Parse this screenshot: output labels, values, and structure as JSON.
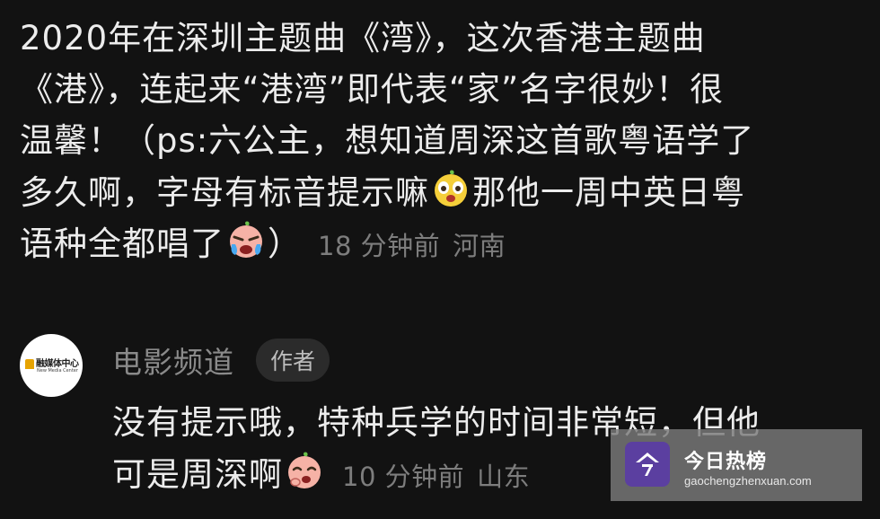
{
  "comment": {
    "lines": [
      "2020年在深圳主题曲《湾》，这次香港主题曲",
      "《港》，连起来“港湾”即代表“家”名字很妙！很",
      "温馨！（ps:六公主，想知道周深这首歌粤语学了",
      "多久啊，字母有标音提示嘛",
      "那他一周中英日粤",
      "语种全都唱了",
      "）"
    ],
    "time": "18 分钟前",
    "location": "河南",
    "emojis": [
      "surprised-face-icon",
      "crying-face-icon"
    ]
  },
  "reply": {
    "author": "电影频道",
    "badge": "作者",
    "avatar": {
      "name": "融媒体中心",
      "sub": "New Media Center"
    },
    "lines": [
      "没有提示哦，特种兵学的时间非常短，但他",
      "可是周深啊"
    ],
    "time": "10 分钟前",
    "location": "山东",
    "emojis": [
      "shy-face-icon"
    ]
  },
  "watermark": {
    "title": "今日热榜",
    "url": "gaochengzhenxuan.com"
  }
}
